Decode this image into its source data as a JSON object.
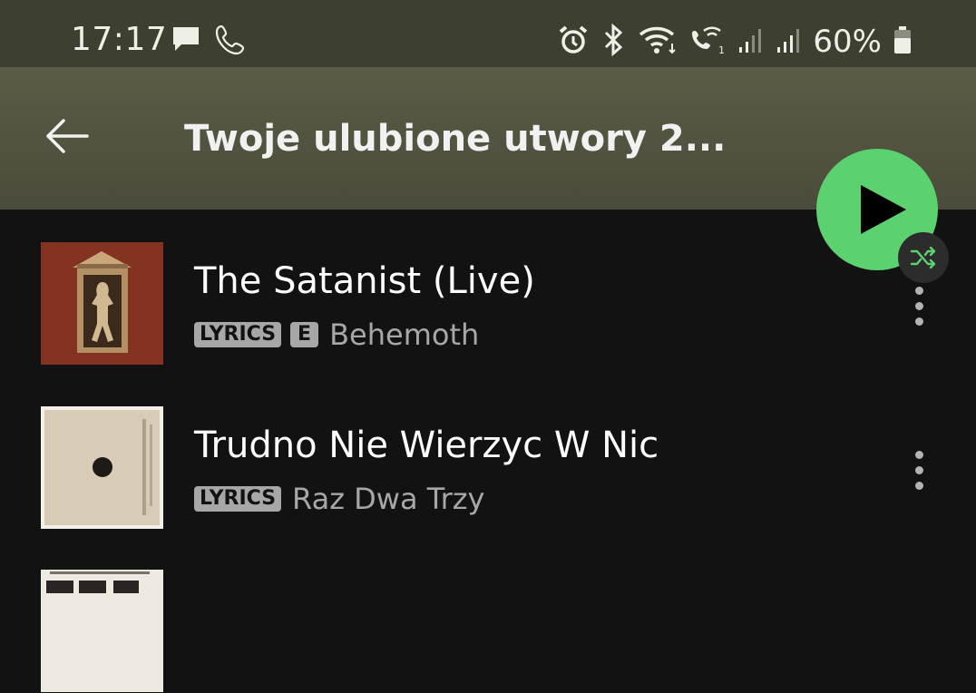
{
  "status_bar": {
    "time": "17:17",
    "left_icons": [
      "message-icon",
      "phone-icon"
    ],
    "right_icons": [
      "alarm-icon",
      "bluetooth-icon",
      "wifi-icon",
      "wifi-call-icon",
      "signal-icon",
      "signal-icon-2",
      "battery-icon"
    ],
    "battery": "60%"
  },
  "header": {
    "title": "Twoje ulubione utwory 2..."
  },
  "colors": {
    "accent": "#5bd26f",
    "header_bg": "#55563f",
    "background": "#121212"
  },
  "tracks": [
    {
      "title": "The Satanist (Live)",
      "badges": [
        "LYRICS",
        "E"
      ],
      "artist": "Behemoth"
    },
    {
      "title": "Trudno Nie Wierzyc W Nic",
      "badges": [
        "LYRICS"
      ],
      "artist": "Raz Dwa Trzy"
    },
    {
      "title": "",
      "badges": [],
      "artist": ""
    }
  ]
}
